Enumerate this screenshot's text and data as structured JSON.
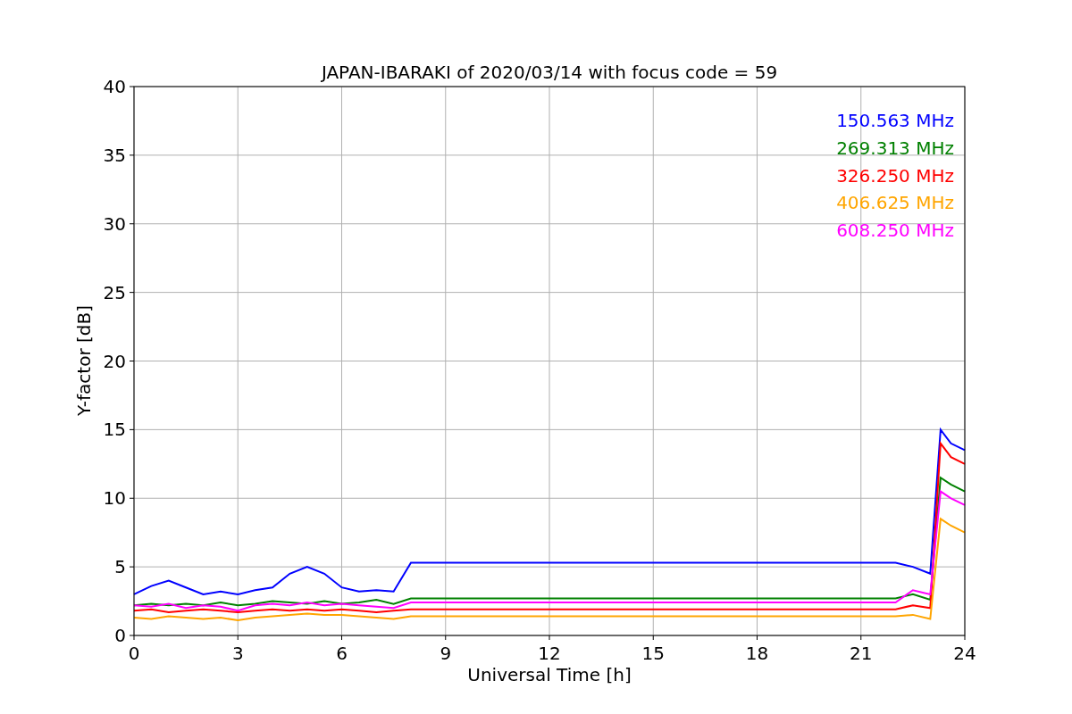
{
  "figure": {
    "chart_data": {
      "type": "line",
      "title": "JAPAN-IBARAKI of 2020/03/14 with focus code = 59",
      "xlabel": "Universal Time [h]",
      "ylabel": "Y-factor [dB]",
      "x": [
        0,
        0.5,
        1,
        1.5,
        2,
        2.5,
        3,
        3.5,
        4,
        4.5,
        5,
        5.5,
        6,
        6.5,
        7,
        7.5,
        8,
        22,
        22.5,
        23,
        23.3,
        23.6,
        24
      ],
      "series": [
        {
          "name": "150.563 MHz",
          "color": "#0000ff",
          "values": [
            3,
            3.6,
            4,
            3.5,
            3,
            3.2,
            3,
            3.3,
            3.5,
            4.5,
            5,
            4.5,
            3.5,
            3.2,
            3.3,
            3.2,
            5.3,
            5.3,
            5,
            4.5,
            15,
            14,
            13.5
          ]
        },
        {
          "name": "269.313 MHz",
          "color": "#008000",
          "values": [
            2.2,
            2.3,
            2.2,
            2.3,
            2.2,
            2.4,
            2.2,
            2.3,
            2.5,
            2.4,
            2.3,
            2.5,
            2.3,
            2.4,
            2.6,
            2.3,
            2.7,
            2.7,
            3,
            2.6,
            11.5,
            11,
            10.5
          ]
        },
        {
          "name": "326.250 MHz",
          "color": "#ff0000",
          "values": [
            1.8,
            1.9,
            1.7,
            1.8,
            1.9,
            1.8,
            1.7,
            1.8,
            1.9,
            1.8,
            1.9,
            1.8,
            1.9,
            1.8,
            1.7,
            1.8,
            1.9,
            1.9,
            2.2,
            2,
            14,
            13,
            12.5
          ]
        },
        {
          "name": "406.625 MHz",
          "color": "#ffa500",
          "values": [
            1.3,
            1.2,
            1.4,
            1.3,
            1.2,
            1.3,
            1.1,
            1.3,
            1.4,
            1.5,
            1.6,
            1.5,
            1.5,
            1.4,
            1.3,
            1.2,
            1.4,
            1.4,
            1.5,
            1.2,
            8.5,
            8,
            7.5
          ]
        },
        {
          "name": "608.250 MHz",
          "color": "#ff00ff",
          "values": [
            2.2,
            2.1,
            2.3,
            2,
            2.2,
            2.1,
            1.8,
            2.2,
            2.3,
            2.2,
            2.4,
            2.2,
            2.3,
            2.2,
            2.1,
            2,
            2.4,
            2.4,
            3.3,
            3,
            10.5,
            10,
            9.5
          ]
        }
      ],
      "xlim": [
        0,
        24
      ],
      "ylim": [
        0,
        40
      ],
      "xticks": [
        0,
        3,
        6,
        9,
        12,
        15,
        18,
        21,
        24
      ],
      "yticks": [
        0,
        5,
        10,
        15,
        20,
        25,
        30,
        35,
        40
      ],
      "grid": true
    }
  }
}
